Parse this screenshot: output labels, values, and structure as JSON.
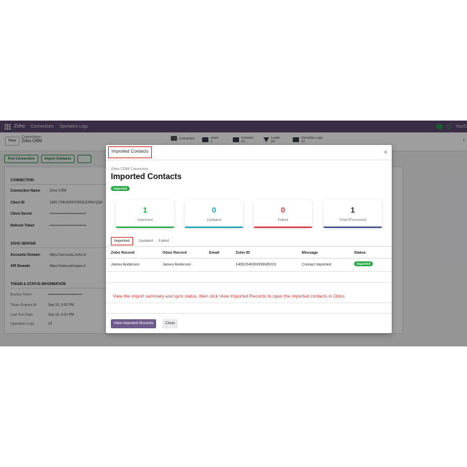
{
  "navbar": {
    "brand": "Zoho",
    "menu": [
      "Connections",
      "Operation Logs"
    ],
    "user": "YourC"
  },
  "control_panel": {
    "new_label": "New",
    "breadcrumb_parent": "Connections",
    "breadcrumb_current": "Zoho CRM",
    "stats": [
      {
        "label": "Connected",
        "value": ""
      },
      {
        "label": "Users",
        "value": "1"
      },
      {
        "label": "Contacts",
        "value": "44"
      },
      {
        "label": "Leads",
        "value": "24"
      },
      {
        "label": "Operation Logs",
        "value": "14"
      }
    ],
    "pager": "1"
  },
  "form": {
    "actions": [
      "Test Connection",
      "Import Contacts"
    ],
    "connection_section": "CONNECTION",
    "connection_name_label": "Connection Name",
    "connection_name": "Zoho CRM",
    "client_id_label": "Client ID",
    "client_id": "1000.TF8UWD6T8R3UCPBXQQF",
    "client_secret_label": "Client Secret",
    "client_secret": "••••••••••••••••••••••••••••••",
    "refresh_token_label": "Refresh Token",
    "refresh_token": "••••••••••••••••••••••••••••••",
    "server_section": "ZOHO SERVER",
    "accounts_domain_label": "Accounts Domain",
    "accounts_domain": "https://accounts.zoho.in",
    "api_domain_label": "API Domain",
    "api_domain": "https://www.zohoapis.in",
    "token_section": "TOKEN & STATUS INFORMATION",
    "access_token_label": "Access Token",
    "access_token": "••••••••••••••••••••••••••••",
    "token_expires_label": "Token Expires At",
    "token_expires": "Sep 16, 5:00 PM",
    "last_test_label": "Last Test Date",
    "last_test": "Sep 16, 4:01 PM",
    "operation_logs_label": "Operation Logs",
    "operation_logs": "14"
  },
  "modal": {
    "title": "Imported Contacts",
    "close": "×",
    "subtitle": "Zoho CRM Connector",
    "heading": "Imported Contacts",
    "status_badge": "Imported",
    "cards": [
      {
        "value": "1",
        "label": "Imported",
        "color": "#28a745"
      },
      {
        "value": "0",
        "label": "Updated",
        "color": "#17a2b8"
      },
      {
        "value": "0",
        "label": "Failed",
        "color": "#dc3545"
      },
      {
        "value": "1",
        "label": "Total Processed",
        "color": "#3a4a8c"
      }
    ],
    "tabs": [
      "Imported",
      "Updated",
      "Failed"
    ],
    "columns": [
      "Zoho Record",
      "Odoo Record",
      "Email",
      "Zoho ID",
      "Message",
      "Status"
    ],
    "row": {
      "zoho_record": "James Anderson",
      "odoo_record": "James Anderson",
      "email": "",
      "zoho_id": "1406154000000645019",
      "message": "Contact imported",
      "status": "Imported"
    },
    "note": "View the import summary and sync status, then click View Imported Records to open the imported contacts in Odoo.",
    "primary_button": "View Imported Records",
    "close_button": "Close"
  },
  "colors": {
    "navbar": "#5c4a72",
    "accent": "#6f5a8c",
    "highlight": "#d0312d",
    "success": "#28a745"
  }
}
